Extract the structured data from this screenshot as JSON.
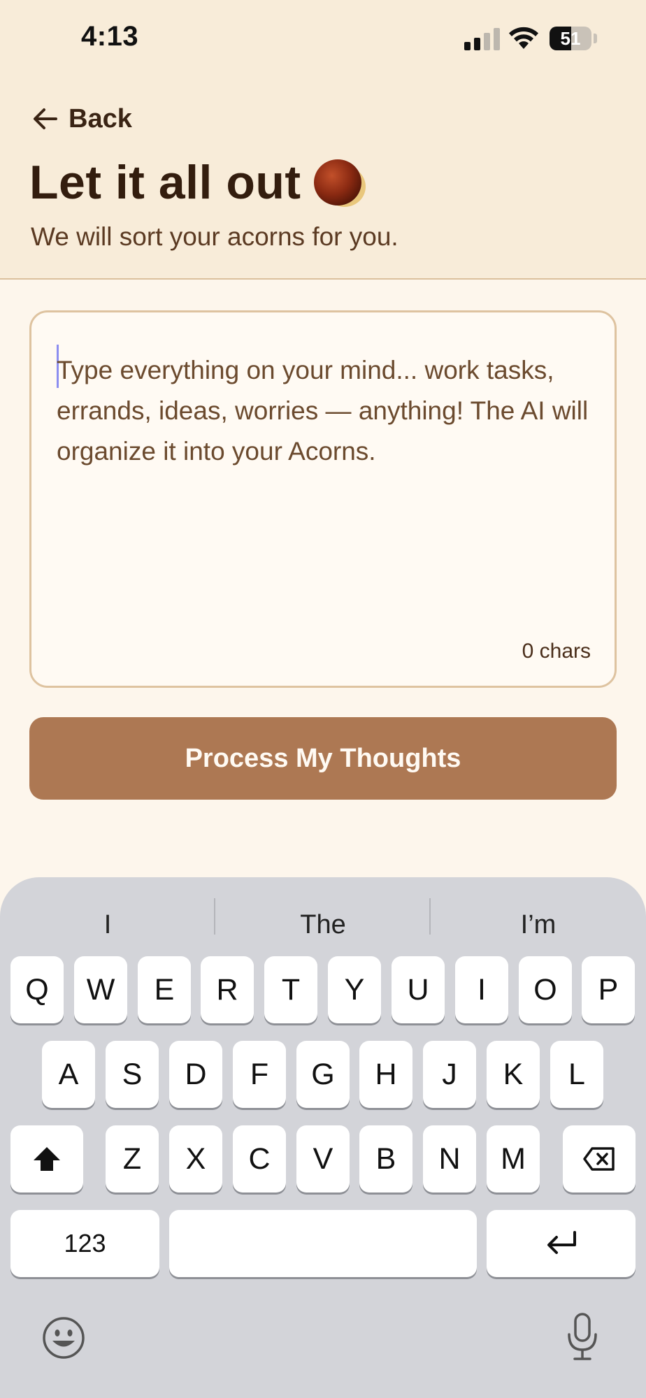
{
  "status_bar": {
    "time": "4:13",
    "battery_percent": "51",
    "battery_level": 0.51
  },
  "header": {
    "back_label": "Back",
    "title": "Let it all out",
    "title_icon": "acorn-icon",
    "subtitle": "We will sort your acorns for you."
  },
  "input": {
    "placeholder": "Type everything on your mind... work tasks, errands, ideas, worries — anything! The AI will organize it into your Acorns.",
    "value": "",
    "char_count": "0 chars"
  },
  "primary_button": {
    "label": "Process My Thoughts"
  },
  "keyboard": {
    "suggestions": [
      "I",
      "The",
      "I’m"
    ],
    "rows": [
      [
        "Q",
        "W",
        "E",
        "R",
        "T",
        "Y",
        "U",
        "I",
        "O",
        "P"
      ],
      [
        "A",
        "S",
        "D",
        "F",
        "G",
        "H",
        "J",
        "K",
        "L"
      ],
      [
        "Z",
        "X",
        "C",
        "V",
        "B",
        "N",
        "M"
      ]
    ],
    "numbers_label": "123",
    "icons": [
      "shift-icon",
      "backspace-icon",
      "return-icon",
      "emoji-icon",
      "microphone-icon"
    ]
  },
  "colors": {
    "header_bg": "#f8ecd9",
    "page_bg": "#fdf6ec",
    "button_bg": "#ad7853",
    "text_dark": "#331d0e",
    "keyboard_bg": "#d3d4d9"
  }
}
